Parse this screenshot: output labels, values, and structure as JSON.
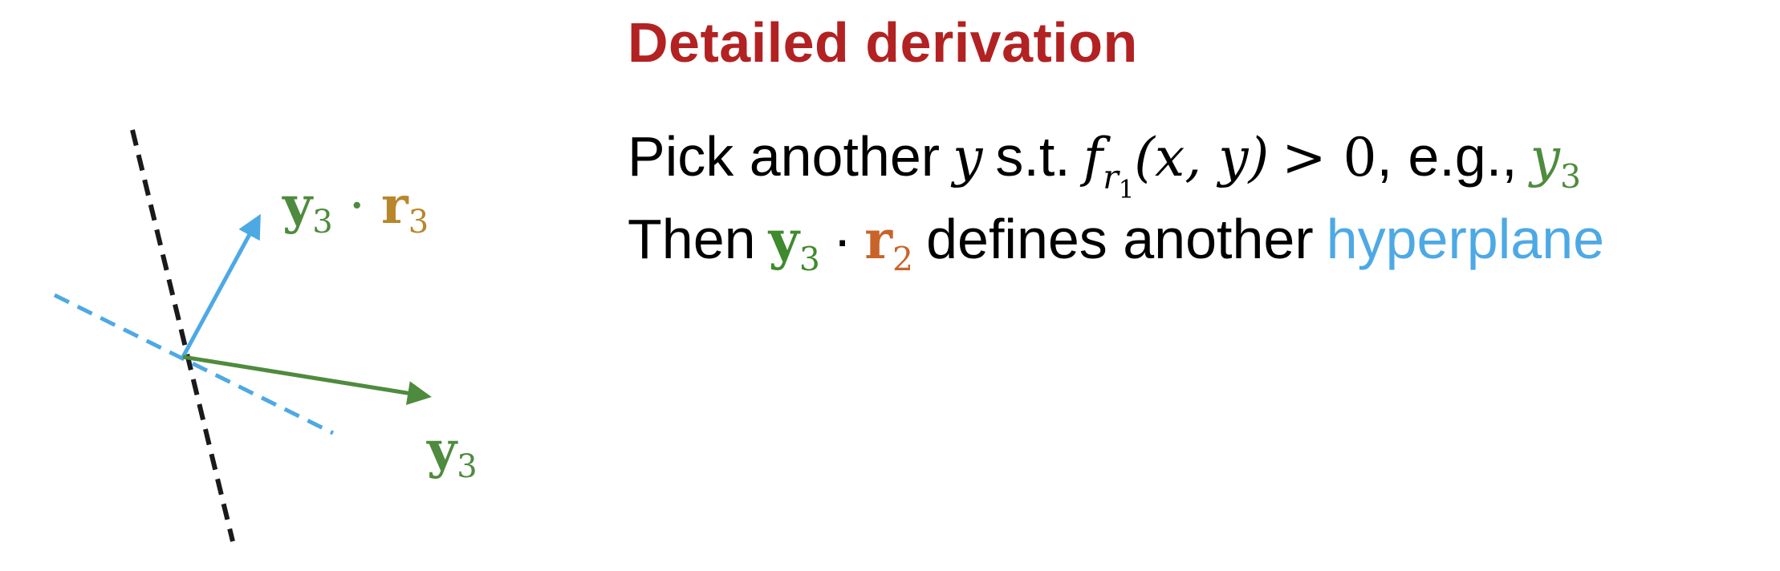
{
  "title": "Detailed derivation",
  "line1": {
    "pick": "Pick another",
    "var_y": "y",
    "st": "s.t.",
    "f": "f",
    "f_sub": "r",
    "f_sub_sub": "1",
    "args": "(x, y)",
    "gt_zero": "> 0",
    "eg": ", e.g.,",
    "example": "y",
    "example_sub": "3"
  },
  "line2": {
    "then": "Then",
    "vec_y": "y",
    "vec_y_sub": "3",
    "dot": "·",
    "vec_r": "r",
    "vec_r_sub": "2",
    "defines": "defines another",
    "hyperplane": "hyperplane"
  },
  "diagram": {
    "top_label": {
      "y": "y",
      "y_sub": "3",
      "dot": "·",
      "r": "r",
      "r_sub": "3"
    },
    "bottom_label": {
      "y": "y",
      "y_sub": "3"
    }
  },
  "colors": {
    "title": "#B22222",
    "green": "#4E8B3E",
    "olive": "#B8862B",
    "orange": "#C8642A",
    "blue": "#4DA9E4",
    "black": "#000000"
  }
}
